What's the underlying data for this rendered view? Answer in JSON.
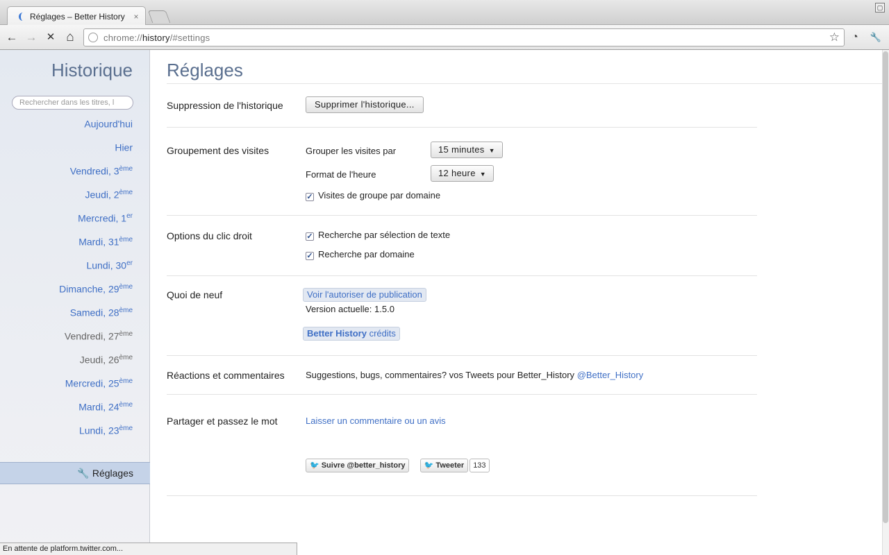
{
  "browser": {
    "tab_title": "Réglages – Better History",
    "tab_close": "×",
    "url_scheme": "chrome://",
    "url_host": "history",
    "url_path": "/#settings",
    "back_icon": "←",
    "forward_icon": "→",
    "stop_icon": "✕",
    "home_icon": "⌂",
    "star_icon": "☆",
    "history_icon": "◔",
    "wrench_icon": "🔧",
    "window_icon": "▢"
  },
  "sidebar": {
    "title": "Historique",
    "search_placeholder": "Rechercher dans les titres, l",
    "days": [
      {
        "label": "Aujourd'hui",
        "sup": ""
      },
      {
        "label": "Hier",
        "sup": ""
      },
      {
        "label": "Vendredi, 3",
        "sup": "ème"
      },
      {
        "label": "Jeudi, 2",
        "sup": "ème"
      },
      {
        "label": "Mercredi, 1",
        "sup": "er"
      },
      {
        "label": "Mardi, 31",
        "sup": "ème"
      },
      {
        "label": "Lundi, 30",
        "sup": "er"
      },
      {
        "label": "Dimanche, 29",
        "sup": "ème"
      },
      {
        "label": "Samedi, 28",
        "sup": "ème"
      },
      {
        "label": "Vendredi, 27",
        "sup": "ème"
      },
      {
        "label": "Jeudi, 26",
        "sup": "ème"
      },
      {
        "label": "Mercredi, 25",
        "sup": "ème"
      },
      {
        "label": "Mardi, 24",
        "sup": "ème"
      },
      {
        "label": "Lundi, 23",
        "sup": "ème"
      }
    ],
    "settings_label": "Réglages"
  },
  "main": {
    "title": "Réglages",
    "delete": {
      "label": "Suppression de l'historique",
      "button": "Supprimer l'historique..."
    },
    "grouping": {
      "label": "Groupement des visites",
      "group_by_label": "Grouper les visites par",
      "group_by_value": "15 minutes",
      "time_format_label": "Format de l'heure",
      "time_format_value": "12 heure",
      "domain_checkbox": "Visites de groupe par domaine"
    },
    "right_click": {
      "label": "Options du clic droit",
      "option_text": "Recherche par sélection de texte",
      "option_domain": "Recherche par domaine"
    },
    "whats_new": {
      "label": "Quoi de neuf",
      "release_link": "Voir l'autoriser de publication",
      "version": "Version actuelle: 1.5.0",
      "credits_bold": "Better History",
      "credits_rest": " crédits"
    },
    "feedback": {
      "label": "Réactions et commentaires",
      "text": "Suggestions, bugs, commentaires? vos Tweets pour Better_History ",
      "handle": "@Better_History"
    },
    "share": {
      "label": "Partager et passez le mot",
      "review_link": "Laisser un commentaire ou un avis",
      "follow_button": "Suivre @better_history",
      "tweet_button": "Tweeter",
      "tweet_count": "133"
    }
  },
  "status_bar": "En attente de platform.twitter.com..."
}
